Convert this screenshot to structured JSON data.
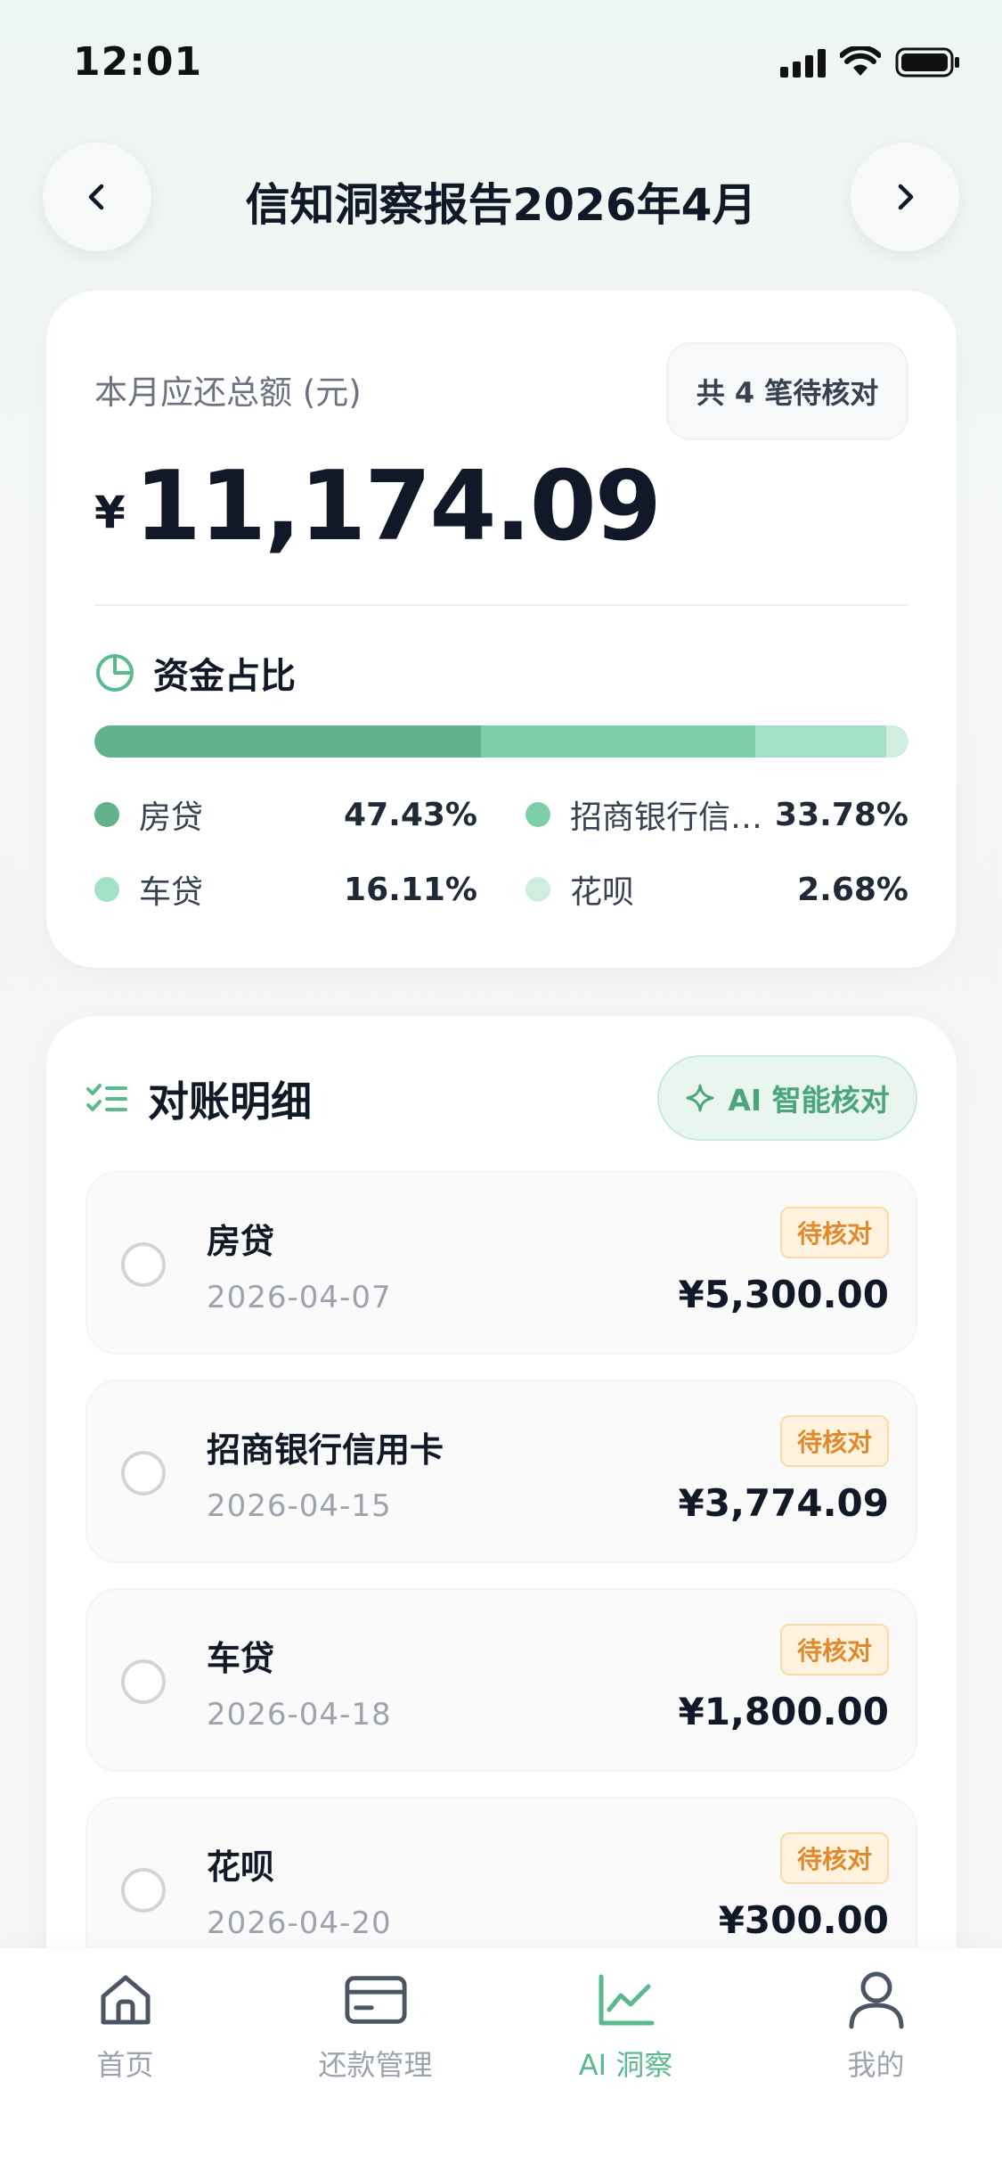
{
  "status_bar": {
    "time": "12:01"
  },
  "header": {
    "title": "信知洞察报告2026年4月"
  },
  "summary": {
    "label": "本月应还总额 (元)",
    "pending_pill": "共 4 笔待核对",
    "currency": "¥",
    "total": "11,174.09",
    "section_title": "资金占比",
    "segments": [
      {
        "name": "房贷",
        "pct_label": "47.43%",
        "value": 47.43,
        "color": "#62b28c"
      },
      {
        "name": "招商银行信用卡",
        "pct_label": "33.78%",
        "value": 33.78,
        "color": "#7dcfaa"
      },
      {
        "name": "车贷",
        "pct_label": "16.11%",
        "value": 16.11,
        "color": "#a3e2c6"
      },
      {
        "name": "花呗",
        "pct_label": "2.68%",
        "value": 2.68,
        "color": "#cfeee0"
      }
    ]
  },
  "details": {
    "title": "对账明细",
    "ai_button": "AI 智能核对",
    "items": [
      {
        "name": "房贷",
        "date": "2026-04-07",
        "badge": "待核对",
        "amount": "¥5,300.00"
      },
      {
        "name": "招商银行信用卡",
        "date": "2026-04-15",
        "badge": "待核对",
        "amount": "¥3,774.09"
      },
      {
        "name": "车贷",
        "date": "2026-04-18",
        "badge": "待核对",
        "amount": "¥1,800.00"
      },
      {
        "name": "花呗",
        "date": "2026-04-20",
        "badge": "待核对",
        "amount": "¥300.00"
      }
    ]
  },
  "tabs": [
    {
      "label": "首页",
      "icon": "home-icon"
    },
    {
      "label": "还款管理",
      "icon": "card-icon"
    },
    {
      "label": "AI 洞察",
      "icon": "chart-line-icon",
      "active": true
    },
    {
      "label": "我的",
      "icon": "user-icon"
    }
  ],
  "colors": {
    "accent": "#5bb98f",
    "badge_text": "#e08a2c",
    "badge_bg": "#fff3e0"
  }
}
